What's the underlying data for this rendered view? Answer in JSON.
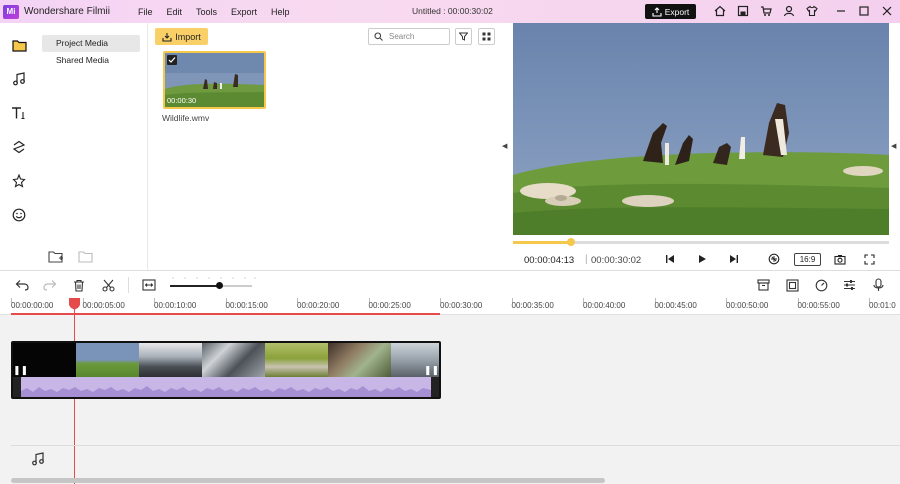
{
  "app": {
    "logo_text": "Mi",
    "name": "Wondershare Filmii",
    "menu": [
      "File",
      "Edit",
      "Tools",
      "Export",
      "Help"
    ],
    "document_title": "Untitled : 00:00:30:02",
    "export_label": "Export"
  },
  "media": {
    "categories": [
      {
        "label": "Project Media",
        "active": true
      },
      {
        "label": "Shared Media",
        "active": false
      }
    ],
    "import_label": "Import",
    "search_placeholder": "Search",
    "items": [
      {
        "name": "Wildlife.wmv",
        "duration": "00:00:30",
        "selected": true
      }
    ]
  },
  "preview": {
    "current_time": "00:00:04:13",
    "separator": "|",
    "total_time": "00:00:30:02",
    "progress_fraction": 0.155,
    "aspect_ratio": "16:9"
  },
  "timeline": {
    "ticks": [
      "00:00:00:00",
      "00:00:05:00",
      "00:00:10:00",
      "00:00:15:00",
      "00:00:20:00",
      "00:00:25:00",
      "00:00:30:00",
      "00:00:35:00",
      "00:00:40:00",
      "00:00:45:00",
      "00:00:50:00",
      "00:00:55:00",
      "00:01:0"
    ],
    "playhead_time": "00:00:04:13",
    "zoom_fraction": 0.6
  },
  "colors": {
    "accent_yellow": "#f9d067",
    "playhead_red": "#e64b4b",
    "audio_purple": "#c8b6e6",
    "titlebar_pink": "#f4d3f4"
  }
}
